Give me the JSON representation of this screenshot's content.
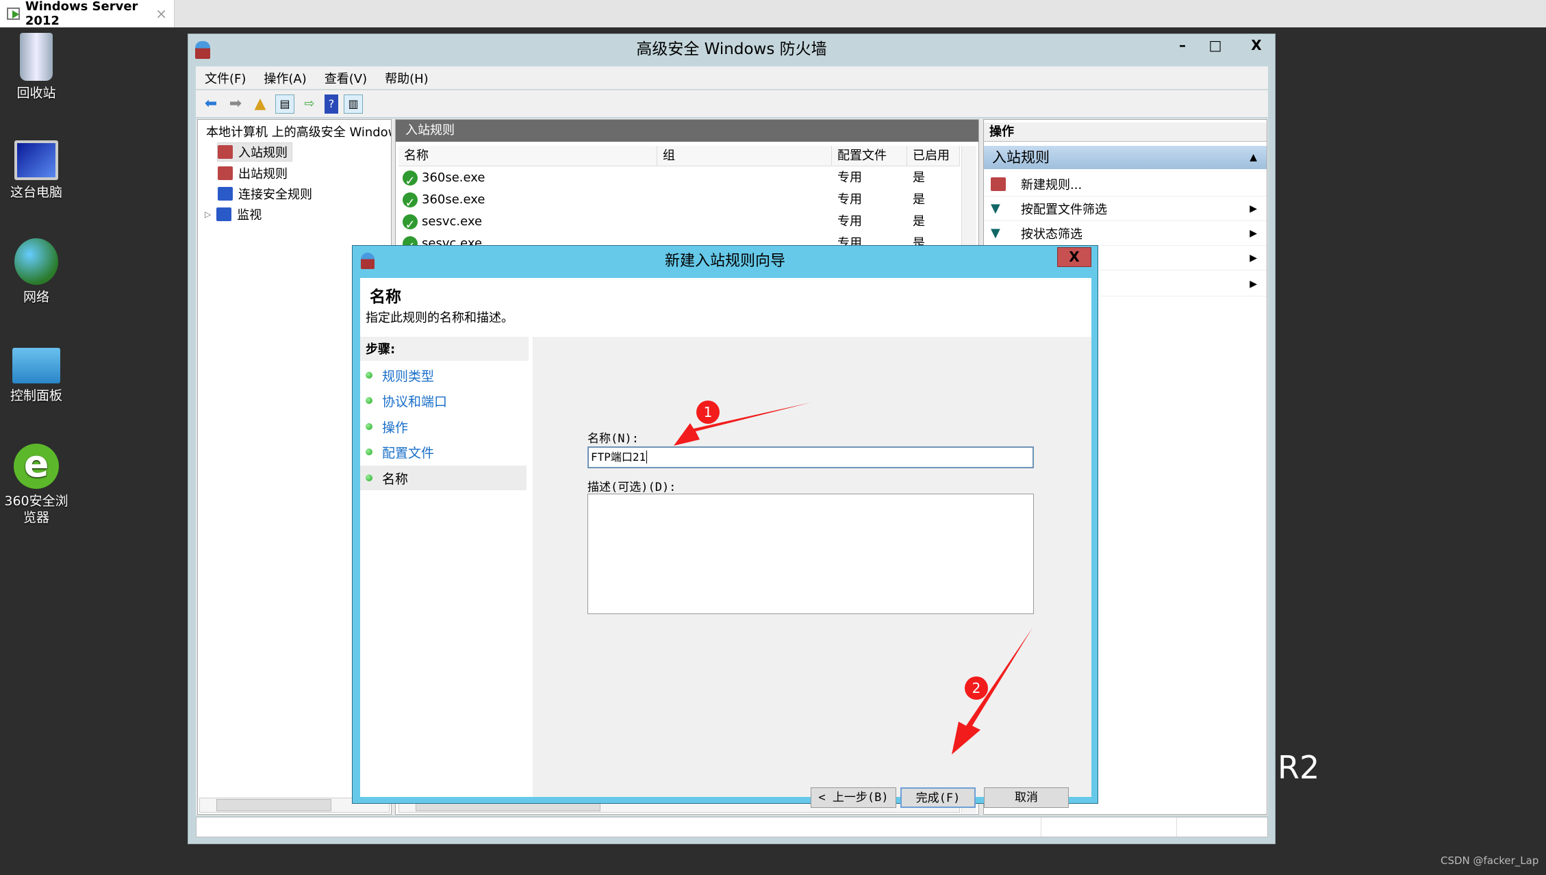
{
  "browser_tab": {
    "title": "Windows Server 2012",
    "close": "×"
  },
  "desktop": {
    "icons": [
      {
        "label": "回收站"
      },
      {
        "label": "这台电脑"
      },
      {
        "label": "网络"
      },
      {
        "label": "控制面板"
      },
      {
        "label": "360安全浏览器"
      }
    ],
    "os_text": "R2"
  },
  "window": {
    "title": "高级安全 Windows 防火墙",
    "controls": {
      "minimize": "–",
      "maximize": "□",
      "close": "X"
    },
    "menu": [
      "文件(F)",
      "操作(A)",
      "查看(V)",
      "帮助(H)"
    ],
    "tree": {
      "root": "本地计算机 上的高级安全 Windows 防火墙",
      "items": [
        "入站规则",
        "出站规则",
        "连接安全规则",
        "监视"
      ]
    },
    "list": {
      "header": "入站规则",
      "columns": [
        "名称",
        "组",
        "配置文件",
        "已启用"
      ],
      "rows": [
        {
          "name": "360se.exe",
          "group": "",
          "profile": "专用",
          "enabled": "是"
        },
        {
          "name": "360se.exe",
          "group": "",
          "profile": "专用",
          "enabled": "是"
        },
        {
          "name": "sesvc.exe",
          "group": "",
          "profile": "专用",
          "enabled": "是"
        },
        {
          "name": "sesvc.exe",
          "group": "",
          "profile": "专用",
          "enabled": "是"
        }
      ]
    },
    "actions": {
      "header": "操作",
      "section": "入站规则",
      "items": [
        "新建规则...",
        "按配置文件筛选",
        "按状态筛选"
      ]
    }
  },
  "dialog": {
    "title": "新建入站规则向导",
    "close": "X",
    "heading": "名称",
    "subheading": "指定此规则的名称和描述。",
    "steps_header": "步骤:",
    "steps": [
      "规则类型",
      "协议和端口",
      "操作",
      "配置文件",
      "名称"
    ],
    "current_step": "名称",
    "name_label": "名称(N):",
    "name_value": "FTP端口21",
    "desc_label": "描述(可选)(D):",
    "desc_value": "",
    "buttons": {
      "back": "< 上一步(B)",
      "finish": "完成(F)",
      "cancel": "取消"
    }
  },
  "annotations": {
    "badge1": "1",
    "badge2": "2",
    "color": "#f21c1c"
  },
  "watermark": "CSDN @facker_Lap"
}
